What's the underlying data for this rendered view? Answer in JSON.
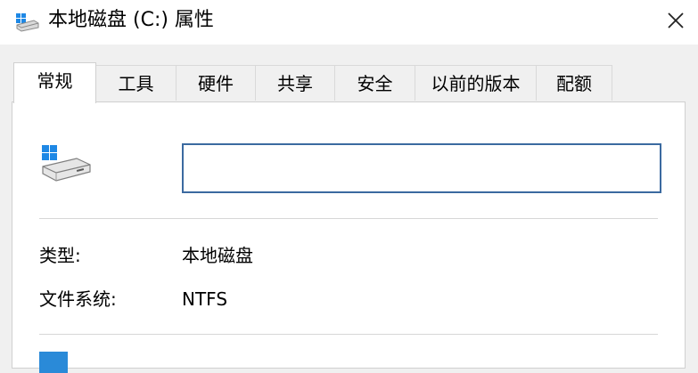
{
  "window": {
    "title": "本地磁盘 (C:) 属性",
    "title_icon": "drive-icon",
    "close_icon": "close-icon"
  },
  "tabs": [
    {
      "label": "常规",
      "active": true
    },
    {
      "label": "工具"
    },
    {
      "label": "硬件"
    },
    {
      "label": "共享"
    },
    {
      "label": "安全"
    },
    {
      "label": "以前的版本"
    },
    {
      "label": "配额"
    }
  ],
  "general": {
    "drive_icon": "windows-drive-icon",
    "name_value": "",
    "type_label": "类型:",
    "type_value": "本地磁盘",
    "fs_label": "文件系统:",
    "fs_value": "NTFS",
    "used_color": "#2a8ad8"
  }
}
